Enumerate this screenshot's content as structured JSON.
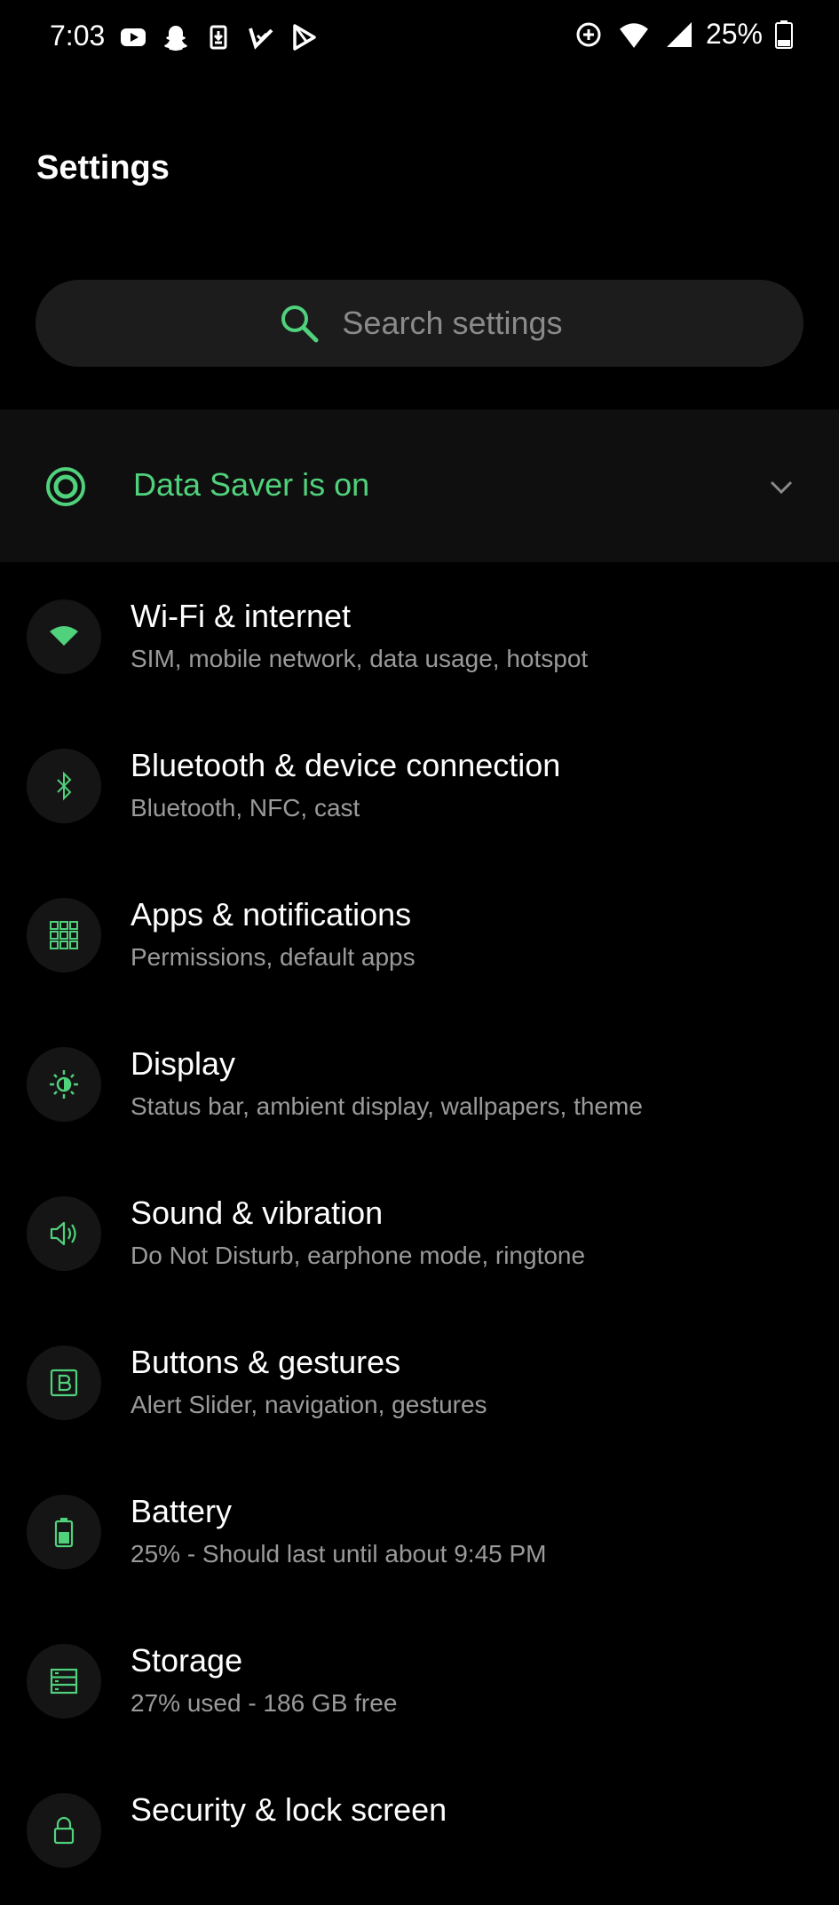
{
  "status_bar": {
    "time": "7:03",
    "battery_percent": "25%",
    "left_icons": [
      "youtube-icon",
      "snapchat-icon",
      "download-icon",
      "check-notification-icon",
      "play-store-icon"
    ],
    "right_icons": [
      "data-saver-icon",
      "wifi-icon",
      "signal-icon",
      "battery-icon"
    ]
  },
  "header": {
    "title": "Settings"
  },
  "search": {
    "placeholder": "Search settings"
  },
  "data_saver": {
    "label": "Data Saver is on",
    "icon": "data-saver-icon"
  },
  "colors": {
    "accent": "#50d17c",
    "background": "#000000",
    "icon_circle": "#151515",
    "secondary_text": "#9a9a9a"
  },
  "settings": [
    {
      "title": "Wi-Fi & internet",
      "subtitle": "SIM, mobile network, data usage, hotspot",
      "icon": "wifi-icon"
    },
    {
      "title": "Bluetooth & device connection",
      "subtitle": "Bluetooth, NFC, cast",
      "icon": "bluetooth-icon"
    },
    {
      "title": "Apps & notifications",
      "subtitle": "Permissions, default apps",
      "icon": "apps-grid-icon"
    },
    {
      "title": "Display",
      "subtitle": "Status bar, ambient display, wallpapers, theme",
      "icon": "brightness-icon"
    },
    {
      "title": "Sound & vibration",
      "subtitle": "Do Not Disturb, earphone mode, ringtone",
      "icon": "speaker-icon"
    },
    {
      "title": "Buttons & gestures",
      "subtitle": "Alert Slider, navigation, gestures",
      "icon": "button-b-icon"
    },
    {
      "title": "Battery",
      "subtitle": "25% - Should last until about 9:45 PM",
      "icon": "battery-icon"
    },
    {
      "title": "Storage",
      "subtitle": "27% used - 186 GB free",
      "icon": "storage-icon"
    },
    {
      "title": "Security & lock screen",
      "subtitle": "",
      "icon": "lock-icon"
    }
  ]
}
